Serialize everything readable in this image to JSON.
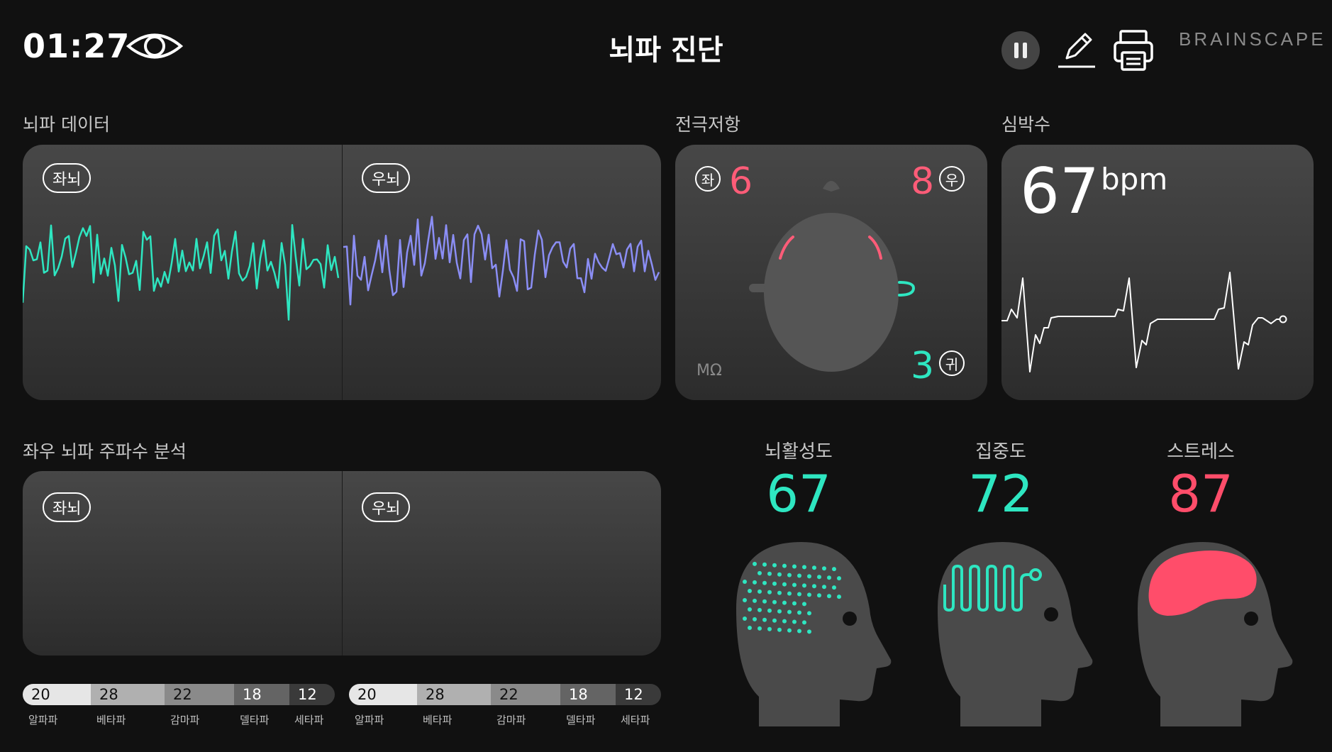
{
  "header": {
    "timer": "01:27",
    "title": "뇌파 진단",
    "brand": "BRAINSCAPE",
    "icons": [
      "eye-icon",
      "pause-icon",
      "edit-icon",
      "print-icon"
    ]
  },
  "eeg": {
    "title": "뇌파 데이터",
    "left_label": "좌뇌",
    "right_label": "우뇌"
  },
  "electrode": {
    "title": "전극저항",
    "left_badge": "좌",
    "left_value": "6",
    "right_badge": "우",
    "right_value": "8",
    "ear_badge": "귀",
    "ear_value": "3",
    "unit": "MΩ"
  },
  "heart": {
    "title": "심박수",
    "value": "67",
    "unit": "bpm"
  },
  "frequency": {
    "title": "좌우 뇌파 주파수 분석",
    "left_label": "좌뇌",
    "right_label": "우뇌",
    "left_bands": [
      {
        "value": "20",
        "label": "알파파"
      },
      {
        "value": "28",
        "label": "베타파"
      },
      {
        "value": "22",
        "label": "감마파"
      },
      {
        "value": "18",
        "label": "델타파"
      },
      {
        "value": "12",
        "label": "세타파"
      }
    ],
    "right_bands": [
      {
        "value": "20",
        "label": "알파파"
      },
      {
        "value": "28",
        "label": "베타파"
      },
      {
        "value": "22",
        "label": "감마파"
      },
      {
        "value": "18",
        "label": "델타파"
      },
      {
        "value": "12",
        "label": "세타파"
      }
    ]
  },
  "metrics": [
    {
      "label": "뇌활성도",
      "value": "67",
      "color": "#2ee6c1"
    },
    {
      "label": "집중도",
      "value": "72",
      "color": "#2ee6c1"
    },
    {
      "label": "스트레스",
      "value": "87",
      "color": "#ff4d6a"
    }
  ],
  "colors": {
    "teal": "#2ee6c1",
    "violet": "#8b8ef5",
    "pink": "#ff5c78"
  }
}
